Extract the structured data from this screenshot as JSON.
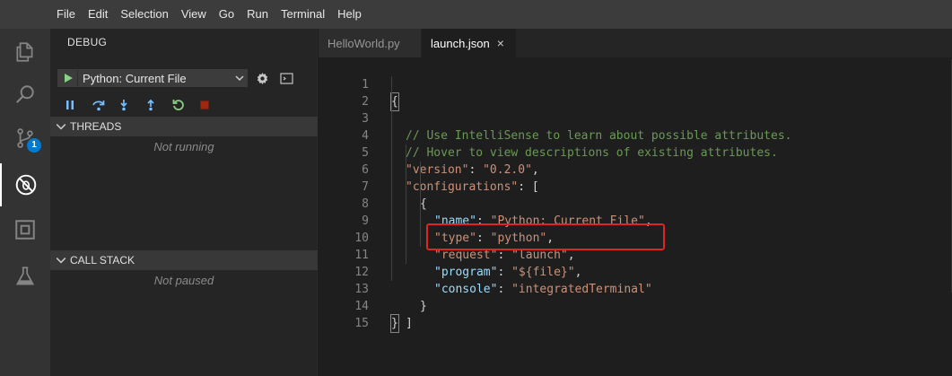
{
  "menu": [
    "File",
    "Edit",
    "Selection",
    "View",
    "Go",
    "Run",
    "Terminal",
    "Help"
  ],
  "activity": {
    "badge": "1"
  },
  "sidebar": {
    "title": "DEBUG",
    "config_name": "Python: Current File",
    "threads": {
      "title": "THREADS",
      "empty": "Not running"
    },
    "callstack": {
      "title": "CALL STACK",
      "empty": "Not paused"
    }
  },
  "tabs": [
    {
      "label": "HelloWorld.py",
      "active": false
    },
    {
      "label": "launch.json",
      "active": true,
      "close": "×"
    }
  ],
  "code": {
    "line_numbers": [
      "1",
      "2",
      "3",
      "4",
      "5",
      "6",
      "7",
      "8",
      "9",
      "10",
      "11",
      "12",
      "13",
      "14",
      "15"
    ],
    "lines": [
      "{",
      "// Use IntelliSense to learn about possible attributes.",
      "// Hover to view descriptions of existing attributes.",
      "\"version\": \"0.2.0\",",
      "\"configurations\": [",
      "{",
      "\"name\": \"Python: Current File\",",
      "\"type\": \"python\",",
      "\"request\": \"launch\",",
      "\"program\": \"${file}\",",
      "\"console\": \"integratedTerminal\"",
      "}",
      "]",
      "}",
      ""
    ],
    "tokens": {
      "l4_key": "\"version\"",
      "l4_val": "\"0.2.0\"",
      "l5_key": "\"configurations\"",
      "l7_key": "\"name\"",
      "l7_val": "\"Python: Current File\"",
      "l8_key": "\"type\"",
      "l8_val": "\"python\"",
      "l9_key": "\"request\"",
      "l9_val": "\"launch\"",
      "l10_key": "\"program\"",
      "l10_val": "\"${file}\"",
      "l11_key": "\"console\"",
      "l11_val": "\"integratedTerminal\""
    }
  },
  "colors": {
    "accent": "#007acc",
    "highlight_box": "#e02424",
    "comment": "#6a9955",
    "string": "#ce9178",
    "key": "#9cdcfe"
  }
}
